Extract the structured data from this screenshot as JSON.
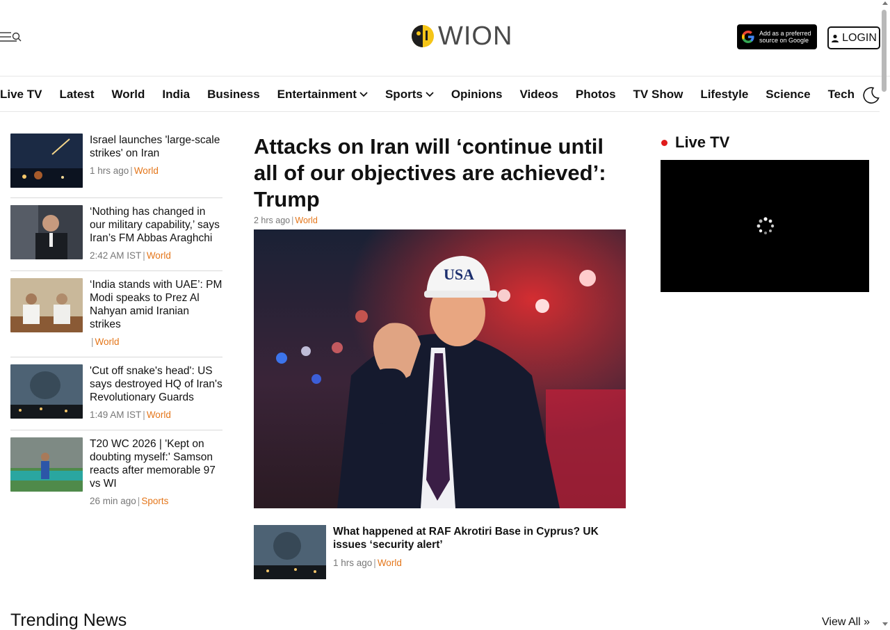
{
  "header": {
    "logo_text": "WION",
    "google_badge": "Add as a preferred source on Google",
    "login_label": "LOGIN"
  },
  "nav": {
    "items": [
      {
        "label": "Live TV"
      },
      {
        "label": "Latest"
      },
      {
        "label": "World"
      },
      {
        "label": "India"
      },
      {
        "label": "Business"
      },
      {
        "label": "Entertainment",
        "dropdown": true
      },
      {
        "label": "Sports",
        "dropdown": true
      },
      {
        "label": "Opinions"
      },
      {
        "label": "Videos"
      },
      {
        "label": "Photos"
      },
      {
        "label": "TV Show"
      },
      {
        "label": "Lifestyle"
      },
      {
        "label": "Science"
      },
      {
        "label": "Tech"
      }
    ]
  },
  "left_stories": [
    {
      "title": "Israel launches 'large-scale strikes' on Iran",
      "time": "1 hrs ago",
      "category": "World"
    },
    {
      "title": "‘Nothing has changed in our military capability,’ says Iran’s FM Abbas Araghchi",
      "time": "2:42 AM IST",
      "category": "World"
    },
    {
      "title": "‘India stands with UAE’: PM Modi speaks to Prez Al Nahyan amid Iranian strikes",
      "time": "",
      "category": "World"
    },
    {
      "title": "'Cut off snake's head': US says destroyed HQ of Iran's Revolutionary Guards",
      "time": "1:49 AM IST",
      "category": "World"
    },
    {
      "title": "T20 WC 2026 | 'Kept on doubting myself:' Samson reacts after memorable 97 vs WI",
      "time": "26 min ago",
      "category": "Sports"
    }
  ],
  "main": {
    "headline": "Attacks on Iran will ‘continue until all of our objectives are achieved’: Trump",
    "time": "2 hrs ago",
    "category": "World",
    "hero_cap_text": "USA",
    "sub_story": {
      "title": "What happened at RAF Akrotiri Base in Cyprus? UK issues ‘security alert’",
      "time": "1 hrs ago",
      "category": "World"
    }
  },
  "live_tv": {
    "title": "Live TV"
  },
  "trending": {
    "title": "Trending News",
    "view_all": "View All »"
  },
  "colors": {
    "accent": "#e4761a",
    "live_dot": "#e01b1b",
    "logo_yellow": "#f5c518"
  },
  "separator": "|"
}
